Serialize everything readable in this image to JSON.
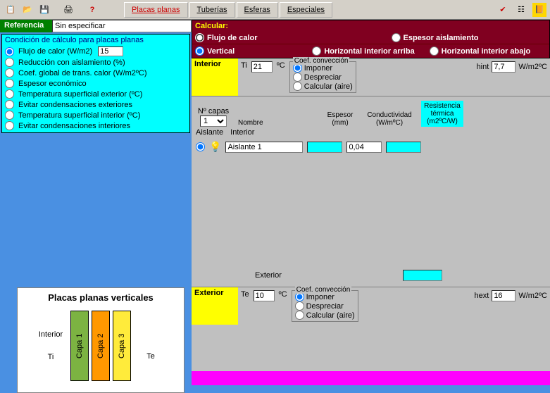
{
  "toolbar": {
    "tabs": [
      "Placas planas",
      "Tuberías",
      "Esferas",
      "Especiales"
    ],
    "active_tab": 0
  },
  "reference": {
    "label": "Referencia",
    "value": "Sin especificar"
  },
  "conditions": {
    "title": "Condición de cálculo para placas planas",
    "items": [
      "Flujo de calor  (W/m2)",
      "Reducción con aislamiento (%)",
      "Coef. global de trans. calor (W/m2ºC)",
      "Espesor económico",
      "Temperatura superficial exterior (ºC)",
      "Evitar condensaciones exteriores",
      "Temperatura superficial interior (ºC)",
      "Evitar condensaciones interiores"
    ],
    "selected": 0,
    "value": "15"
  },
  "calc": {
    "title": "Calcular:",
    "opts": [
      "Flujo de calor",
      "Espesor aislamiento"
    ],
    "selected": 0,
    "orient": [
      "Vertical",
      "Horizontal interior arriba",
      "Horizontal interior abajo"
    ],
    "orient_selected": 0
  },
  "interior": {
    "label": "Interior",
    "ti_label": "Ti",
    "ti_value": "21",
    "unit": "ºC",
    "coef_title": "Coef. convección",
    "coef_opts": [
      "Imponer",
      "Despreciar",
      "Calcular (aire)"
    ],
    "coef_selected": 0,
    "hint_label": "hint",
    "hint_value": "7,7",
    "hint_unit": "W/m2ºC"
  },
  "layers": {
    "ncapas_label": "Nº capas",
    "ncapas_value": "1",
    "cols": [
      "Nombre",
      "Espesor (mm)",
      "Conductividad (W/mºC)",
      "Resistencia térmica (m2ºC/W)"
    ],
    "aislante_label": "Aislante",
    "interior_sub": "Interior",
    "row_name": "Aislante 1",
    "row_cond": "0,04",
    "exterior_label": "Exterior"
  },
  "exterior": {
    "label": "Exterior",
    "te_label": "Te",
    "te_value": "10",
    "unit": "ºC",
    "coef_title": "Coef. convección",
    "coef_opts": [
      "Imponer",
      "Despreciar",
      "Calcular (aire)"
    ],
    "coef_selected": 0,
    "hext_label": "hext",
    "hext_value": "16",
    "hext_unit": "W/m2ºC"
  },
  "diagram": {
    "title": "Placas planas verticales",
    "interior": "Interior",
    "ti": "Ti",
    "te": "Te",
    "capas": [
      "Capa 1",
      "Capa 2",
      "Capa 3"
    ]
  }
}
